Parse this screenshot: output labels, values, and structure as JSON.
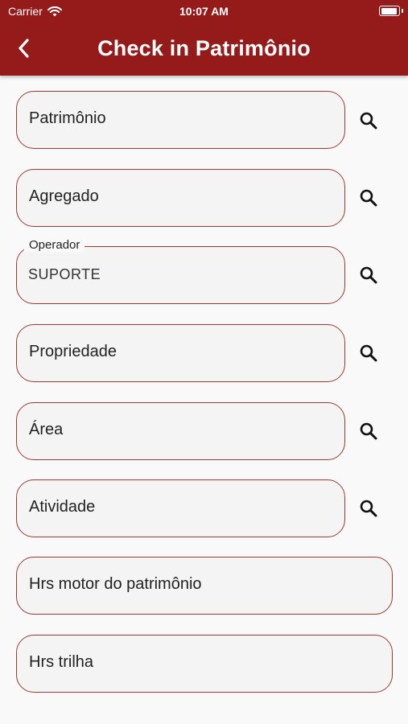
{
  "status_bar": {
    "carrier": "Carrier",
    "time": "10:07 AM",
    "battery_level": 0.95
  },
  "header": {
    "title": "Check in Patrimônio",
    "back_icon": "chevron-left-icon"
  },
  "colors": {
    "brand": "#951b1b",
    "field_border": "#9c3a3a",
    "background": "#f9f9f9"
  },
  "form": {
    "patrimonio": {
      "placeholder": "Patrimônio"
    },
    "agregado": {
      "placeholder": "Agregado"
    },
    "operador": {
      "label": "Operador",
      "value": "SUPORTE"
    },
    "propriedade": {
      "placeholder": "Propriedade"
    },
    "area": {
      "placeholder": "Área"
    },
    "atividade": {
      "placeholder": "Atividade"
    },
    "hrs_motor": {
      "placeholder": "Hrs motor do patrimônio"
    },
    "hrs_trilha": {
      "placeholder": "Hrs trilha"
    }
  },
  "search_icon": "search-icon"
}
